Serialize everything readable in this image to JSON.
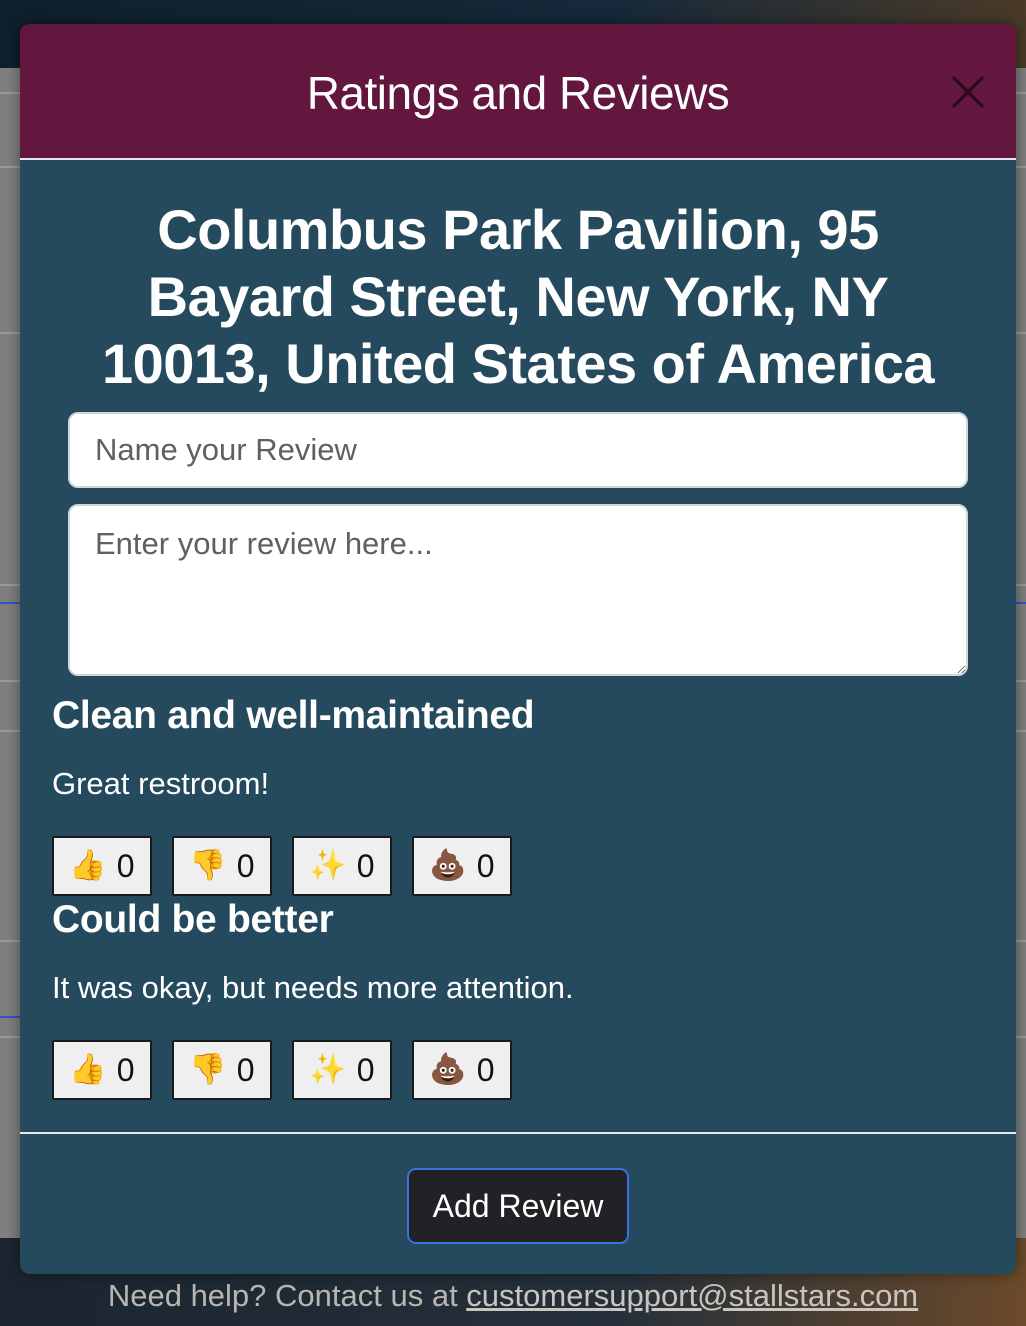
{
  "modal": {
    "title": "Ratings and Reviews",
    "location": "Columbus Park Pavilion, 95 Bayard Street, New York, NY 10013, United States of America",
    "name_placeholder": "Name your Review",
    "review_placeholder": "Enter your review here...",
    "add_review_label": "Add Review"
  },
  "reviews": [
    {
      "title": "Clean and well-maintained",
      "text": "Great restroom!",
      "reactions": [
        {
          "emoji": "👍",
          "icon": "thumbs-up-icon",
          "count": "0"
        },
        {
          "emoji": "👎",
          "icon": "thumbs-down-icon",
          "count": "0"
        },
        {
          "emoji": "✨",
          "icon": "sparkles-icon",
          "count": "0"
        },
        {
          "emoji": "💩",
          "icon": "poop-icon",
          "count": "0"
        }
      ]
    },
    {
      "title": "Could be better",
      "text": "It was okay, but needs more attention.",
      "reactions": [
        {
          "emoji": "👍",
          "icon": "thumbs-up-icon",
          "count": "0"
        },
        {
          "emoji": "👎",
          "icon": "thumbs-down-icon",
          "count": "0"
        },
        {
          "emoji": "✨",
          "icon": "sparkles-icon",
          "count": "0"
        },
        {
          "emoji": "💩",
          "icon": "poop-icon",
          "count": "0"
        }
      ]
    }
  ],
  "footer": {
    "text": "Need help? Contact us at ",
    "email": "customersupport@stallstars.com"
  },
  "colors": {
    "header": "#63163e",
    "body": "#254a5e",
    "button": "#202225",
    "button_border": "#3b6fe0"
  }
}
